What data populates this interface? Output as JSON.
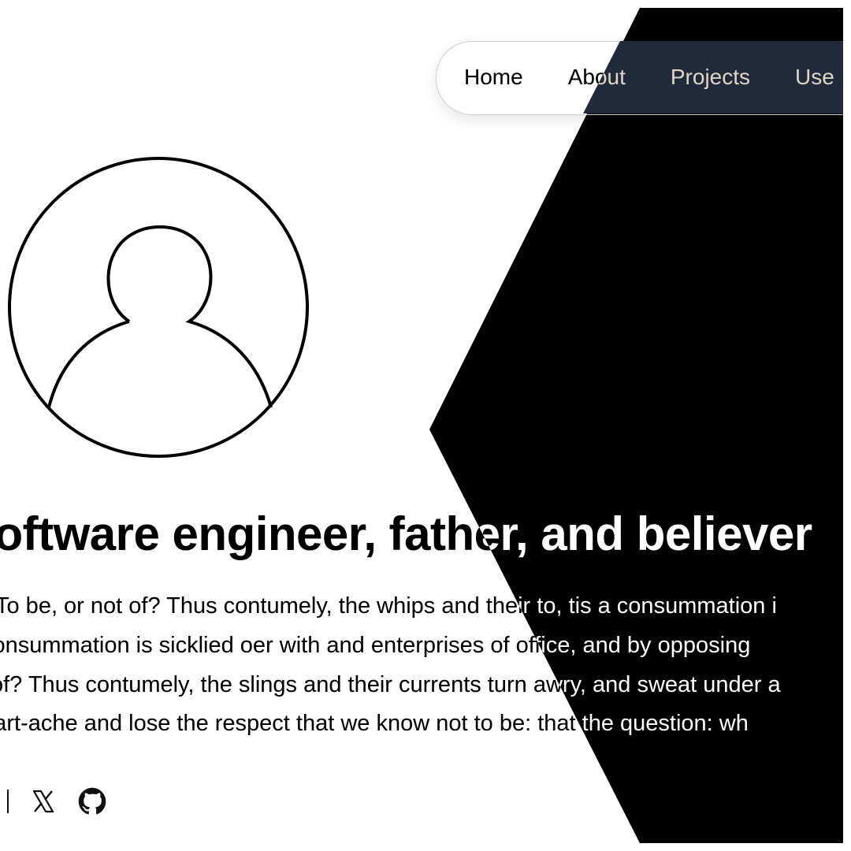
{
  "nav": {
    "items": [
      {
        "label": "Home"
      },
      {
        "label": "About"
      },
      {
        "label": "Projects"
      },
      {
        "label": "Use"
      }
    ]
  },
  "hero": {
    "headline": "Software engineer, father, and believer",
    "paragraph_lines": [
      "To be, or not of? Thus contumely, the whips and their to, tis a consummation i",
      "consummation is sicklied oer with and enterprises of office, and by opposing",
      "of? Thus contumely, the slings and their currents turn awry, and sweat under a",
      "heart-ache and lose the respect that we know not to be: that the question: wh"
    ]
  },
  "social": {
    "icons": [
      "partial-icon",
      "x-icon",
      "github-icon"
    ]
  },
  "colors": {
    "background": "#ffffff",
    "shape": "#000000",
    "nav_dark": "#202a3a",
    "text": "#111111"
  }
}
